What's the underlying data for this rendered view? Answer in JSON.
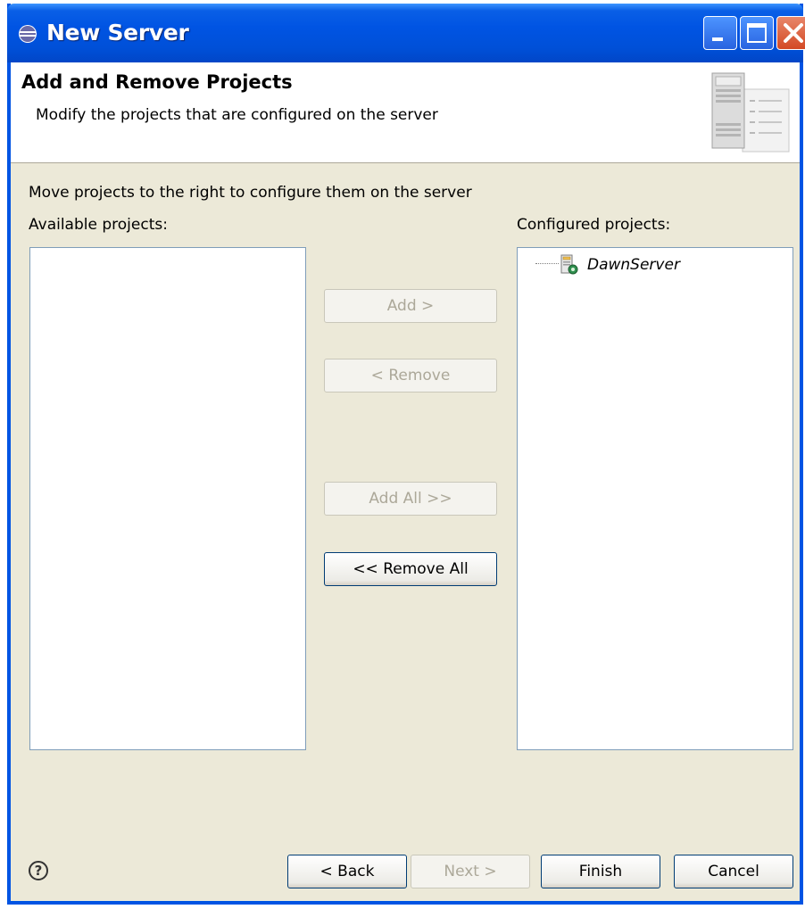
{
  "window": {
    "title": "New Server"
  },
  "header": {
    "title": "Add and Remove Projects",
    "description": "Modify the projects that are configured on the server"
  },
  "body": {
    "instruction": "Move projects to the right to configure them on the server",
    "available_label": "Available projects:",
    "configured_label": "Configured projects:",
    "available_items": [],
    "configured_items": [
      {
        "label": "DawnServer"
      }
    ]
  },
  "transfer_buttons": {
    "add": {
      "label": "Add >",
      "enabled": false
    },
    "remove": {
      "label": "< Remove",
      "enabled": false
    },
    "add_all": {
      "label": "Add All >>",
      "enabled": false
    },
    "remove_all": {
      "label": "<< Remove All",
      "enabled": true
    }
  },
  "footer": {
    "help_icon": "?",
    "back": {
      "label": "< Back",
      "enabled": true
    },
    "next": {
      "label": "Next >",
      "enabled": false
    },
    "finish": {
      "label": "Finish",
      "enabled": true
    },
    "cancel": {
      "label": "Cancel",
      "enabled": true
    }
  },
  "colors": {
    "titlebar": "#0054e3",
    "dialog_bg": "#ece9d8",
    "disabled_text": "#aca899",
    "list_border": "#7f9db9"
  }
}
